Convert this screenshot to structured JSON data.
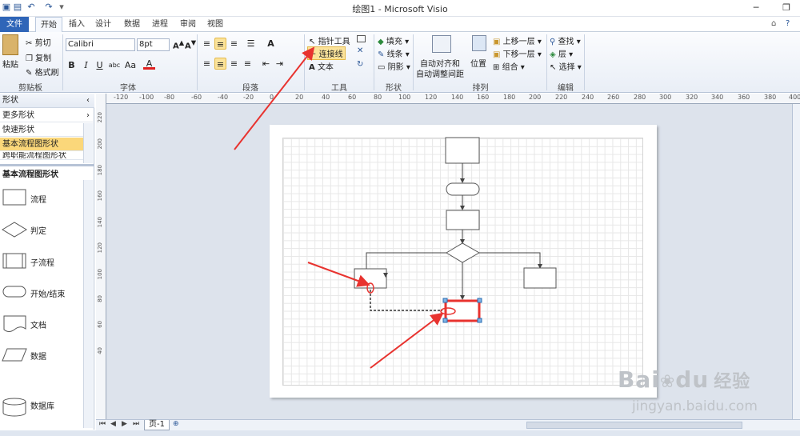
{
  "window": {
    "title": "绘图1 - Microsoft Visio"
  },
  "tabs": [
    {
      "label": "文件"
    },
    {
      "label": "开始"
    },
    {
      "label": "插入"
    },
    {
      "label": "设计"
    },
    {
      "label": "数据"
    },
    {
      "label": "进程"
    },
    {
      "label": "审阅"
    },
    {
      "label": "视图"
    }
  ],
  "ribbon": {
    "clipboard": {
      "label": "剪贴板",
      "paste": "粘贴",
      "cut": "剪切",
      "copy": "复制",
      "format_painter": "格式刷"
    },
    "font": {
      "label": "字体",
      "name": "Calibri",
      "size": "8pt",
      "bold": "B",
      "italic": "I",
      "underline": "U",
      "strike": "abc",
      "case": "Aa",
      "color": "A"
    },
    "paragraph": {
      "label": "段落"
    },
    "tools": {
      "label": "工具",
      "pointer": "指针工具",
      "connector": "连接线",
      "text": "文本"
    },
    "shape": {
      "label": "形状",
      "fill": "填充",
      "line": "线条",
      "shadow": "阴影"
    },
    "arrange": {
      "label": "排列",
      "auto_align": "自动对齐和",
      "auto_align2": "自动调整间距",
      "position": "位置",
      "bring_forward": "上移一层",
      "send_backward": "下移一层",
      "group": "组合"
    },
    "editing": {
      "label": "编辑",
      "find": "查找",
      "layers": "层",
      "select": "选择"
    }
  },
  "shapes_panel": {
    "title": "形状",
    "more": "更多形状",
    "quick": "快速形状",
    "basic_flow": "基本流程图形状",
    "cross_func": "跨职能流程图形状",
    "stencil_title": "基本流程图形状",
    "items": [
      {
        "label": "流程"
      },
      {
        "label": "判定"
      },
      {
        "label": "子流程"
      },
      {
        "label": "开始/结束"
      },
      {
        "label": "文档"
      },
      {
        "label": "数据"
      },
      {
        "label": "数据库"
      }
    ]
  },
  "ruler": {
    "top": [
      "-120",
      "-100",
      "-80",
      "-60",
      "-40",
      "-20",
      "0",
      "20",
      "40",
      "60",
      "80",
      "100",
      "120",
      "140",
      "160",
      "180",
      "200",
      "220",
      "240",
      "260",
      "280",
      "300",
      "320",
      "340",
      "360",
      "380",
      "400"
    ],
    "left": [
      "220",
      "200",
      "180",
      "160",
      "140",
      "120",
      "100",
      "80",
      "60",
      "40"
    ]
  },
  "page_tab": {
    "label": "页-1"
  },
  "watermark": {
    "brand": "Bai",
    "brand2": "经验",
    "url": "jingyan.baidu.com"
  },
  "colors": {
    "accent": "#2f65b8",
    "annotation": "#e8332f",
    "selection": "#fbe39a"
  }
}
